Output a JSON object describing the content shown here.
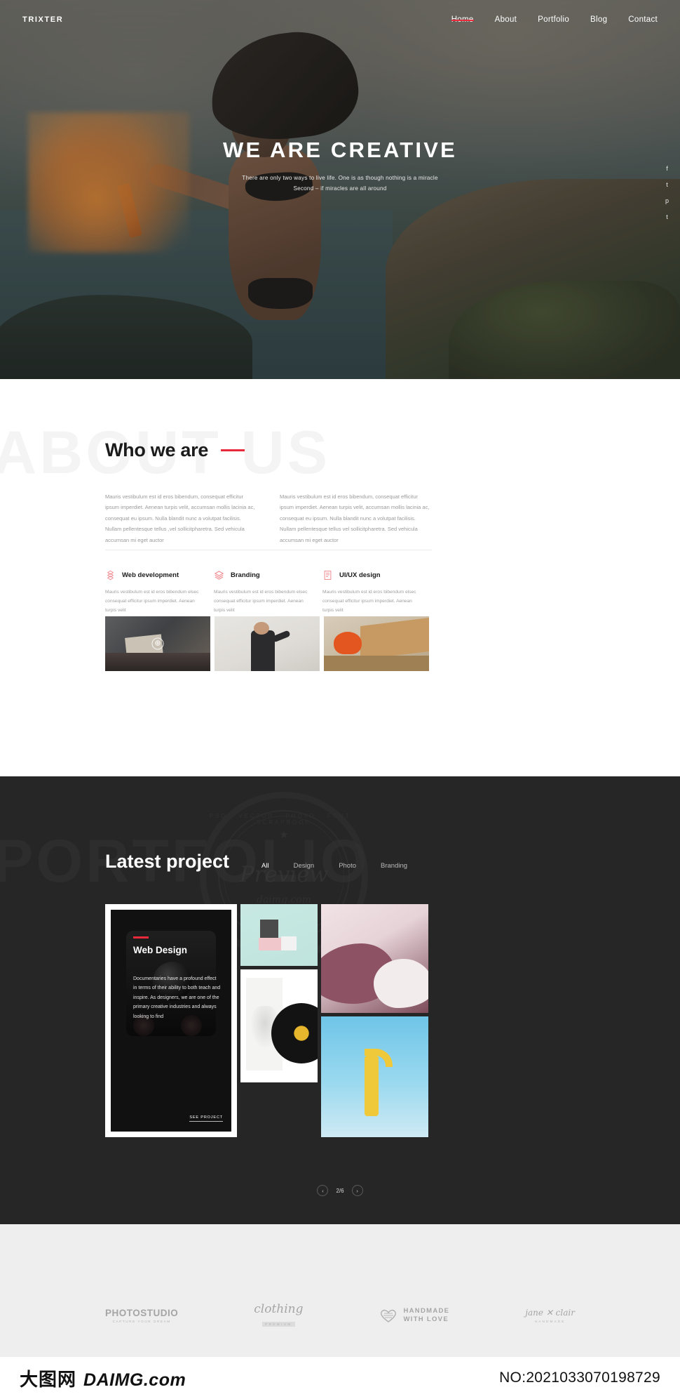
{
  "header": {
    "logo": "TRIXTER",
    "nav": [
      {
        "label": "Home",
        "active": true
      },
      {
        "label": "About",
        "active": false
      },
      {
        "label": "Portfolio",
        "active": false
      },
      {
        "label": "Blog",
        "active": false
      },
      {
        "label": "Contact",
        "active": false
      }
    ]
  },
  "hero": {
    "title": "WE ARE CREATIVE",
    "subtitle_line1": "There are only two ways to live life. One is as though nothing is a miracle",
    "subtitle_line2": "Second – if miracles are all around",
    "social": [
      "f",
      "t",
      "p",
      "t"
    ]
  },
  "about": {
    "ghost": "ABOUT US",
    "heading": "Who we are",
    "paragraph1": "Mauris vestibulum est id eros bibendum, consequat efficitur ipsum imperdiet. Aenean turpis velit, accumsan mollis lacinia ac, consequat eu ipsum. Nulla blandit nunc a volutpat facilisis. Nullam pellentesque tellus ,vel sollicitpharetra. Sed vehicula accumsan mi eget auctor",
    "paragraph2": "Mauris vestibulum est id eros bibendum, consequat efficitur ipsum imperdiet. Aenean turpis velit, accumsan mollis lacinia ac, consequat eu ipsum. Nulla blandit nunc a volutpat facilisis. Nullam pellentesque tellus vel sollicitpharetra. Sed vehicula accumsan mi eget auctor",
    "services": [
      {
        "icon": "boxes-icon",
        "title": "Web development",
        "text": "Mauris vestibulum est id eros bibendum elsec consequat efficitur ipsum imperdiet. Aenean turpis velit"
      },
      {
        "icon": "layers-icon",
        "title": "Branding",
        "text": "Mauris vestibulum est id eros bibendum elsec consequat efficitur ipsum imperdiet. Aenean turpis velit"
      },
      {
        "icon": "document-icon",
        "title": "UI/UX design",
        "text": "Mauris vestibulum est id eros bibendum elsec consequat efficitur ipsum imperdiet. Aenean turpis velit"
      }
    ]
  },
  "portfolio": {
    "ghost": "PORTFOLIO",
    "heading": "Latest project",
    "filters": [
      {
        "label": "All",
        "active": true
      },
      {
        "label": "Design",
        "active": false
      },
      {
        "label": "Photo",
        "active": false
      },
      {
        "label": "Branding",
        "active": false
      }
    ],
    "feature": {
      "title": "Web Design",
      "text": "Documentaries have a profound effect in terms of their ability to both teach and inspire. As designers, we are one of the primary creative industries and always looking to find",
      "link": "SEE PROJECT"
    },
    "pager": {
      "prev": "‹",
      "next": "›",
      "count": "2/6"
    },
    "watermark": {
      "top": "PSD · VECTOR · PHOTO · FONT · SCRAPBOOK",
      "preview": "Preview",
      "domain": "daimg.com"
    }
  },
  "partners": [
    {
      "name": "PHOTOSTUDIO",
      "sub": "CAPTURE YOUR DREAM"
    },
    {
      "name": "clothing",
      "sub": "PREMIUM"
    },
    {
      "name_line1": "HANDMADE",
      "name_line2": "WITH LOVE",
      "icon": "heart-icon"
    },
    {
      "name": "jane ✕ clair",
      "sub": "HANDMADE"
    }
  ],
  "bottombar": {
    "brand_cn": "大图网",
    "brand_en": "DAIMG.com",
    "serial": "NO:2021033070198729"
  },
  "colors": {
    "accent": "#e8293b",
    "dark": "#262626",
    "muted": "#9a9a9a"
  }
}
